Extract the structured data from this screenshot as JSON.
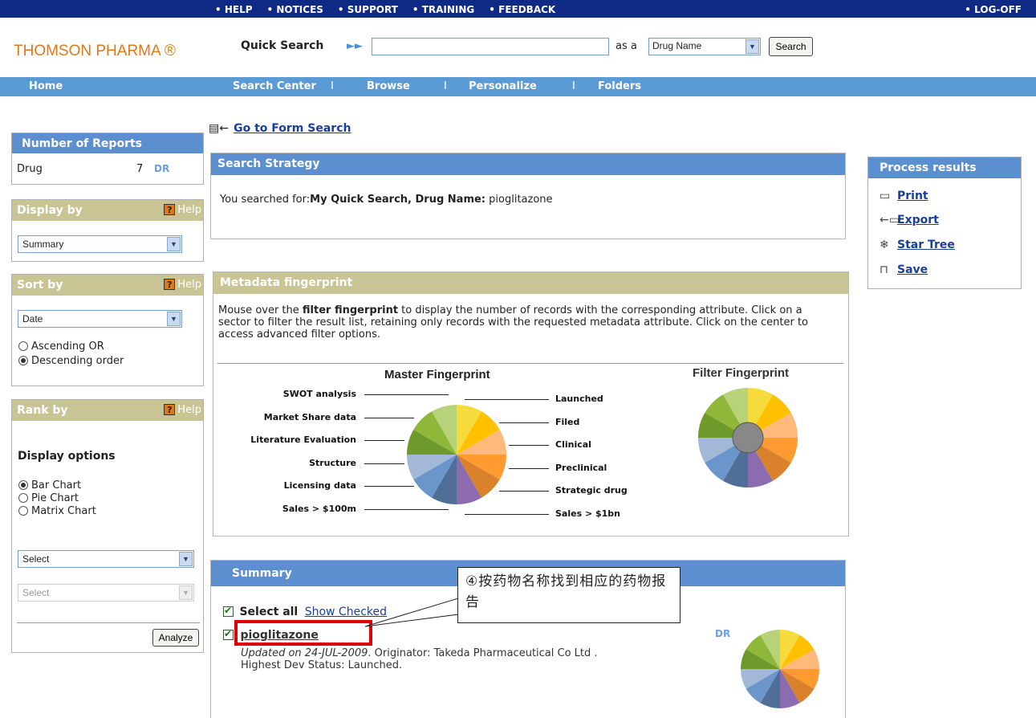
{
  "topbar": {
    "links": [
      "• HELP",
      "• NOTICES",
      "• SUPPORT",
      "• TRAINING",
      "• FEEDBACK"
    ],
    "logoff": "• LOG-OFF"
  },
  "brand": "THOMSON PHARMA ®",
  "quick_search": {
    "label": "Quick Search",
    "value": "",
    "as_a": "as a",
    "type": "Drug Name",
    "button": "Search"
  },
  "nav": [
    "Home",
    "Search Center",
    "I",
    "Browse",
    "I",
    "Personalize",
    "I",
    "Folders"
  ],
  "sidebar": {
    "reports": {
      "title": "Number of Reports",
      "label": "Drug",
      "count": "7",
      "tag": "DR"
    },
    "display": {
      "title": "Display by",
      "help": "Help",
      "value": "Summary"
    },
    "sort": {
      "title": "Sort by",
      "help": "Help",
      "value": "Date",
      "asc": "Ascending OR",
      "desc": "Descending order"
    },
    "rank": {
      "title": "Rank by",
      "help": "Help",
      "display_options": "Display options",
      "options": [
        "Bar Chart",
        "Pie Chart",
        "Matrix Chart"
      ],
      "select1": "Select",
      "select2": "Select",
      "analyze": "Analyze"
    }
  },
  "goto_form": "Go to Form Search",
  "strategy": {
    "title": "Search Strategy",
    "prefix": "You searched for:",
    "bold": "My Quick Search, Drug Name:",
    "term": " pioglitazone"
  },
  "fingerprint": {
    "title": "Metadata fingerprint",
    "desc_1": "Mouse over the ",
    "desc_bold": "filter fingerprint",
    "desc_2": " to display the number of records with the corresponding attribute. Click on a sector to filter the result list, retaining only records with the requested metadata attribute. Click on the center to access advanced filter options.",
    "master_title": "Master Fingerprint",
    "filter_title": "Filter Fingerprint",
    "left_labels": [
      "SWOT analysis",
      "Market Share data",
      "Literature Evaluation",
      "Structure",
      "Licensing data",
      "Sales > $100m"
    ],
    "right_labels": [
      "Launched",
      "Filed",
      "Clinical",
      "Preclinical",
      "Strategic drug",
      "Sales > $1bn"
    ],
    "colors": [
      "#f5dc3c",
      "#ffc000",
      "#ffb97a",
      "#ff9a30",
      "#d9822b",
      "#8c6bb1",
      "#4f6f99",
      "#6a96cc",
      "#a3b8d6",
      "#6e9a2b",
      "#8fb83a",
      "#b8d27a"
    ]
  },
  "summary": {
    "title": "Summary",
    "select_all": "Select all",
    "show_checked": "Show Checked",
    "item": "pioglitazone",
    "updated_prefix": "Updated on 24-JUL-2009",
    "updated_rest": ". Originator: Takeda Pharmaceutical Co Ltd .",
    "status": "Highest Dev Status: Launched.",
    "tag": "DR"
  },
  "annotation": "④按药物名称找到相应的药物报告",
  "process": {
    "title": "Process results",
    "actions": [
      "Print",
      "Export",
      "Star Tree",
      "Save"
    ]
  }
}
